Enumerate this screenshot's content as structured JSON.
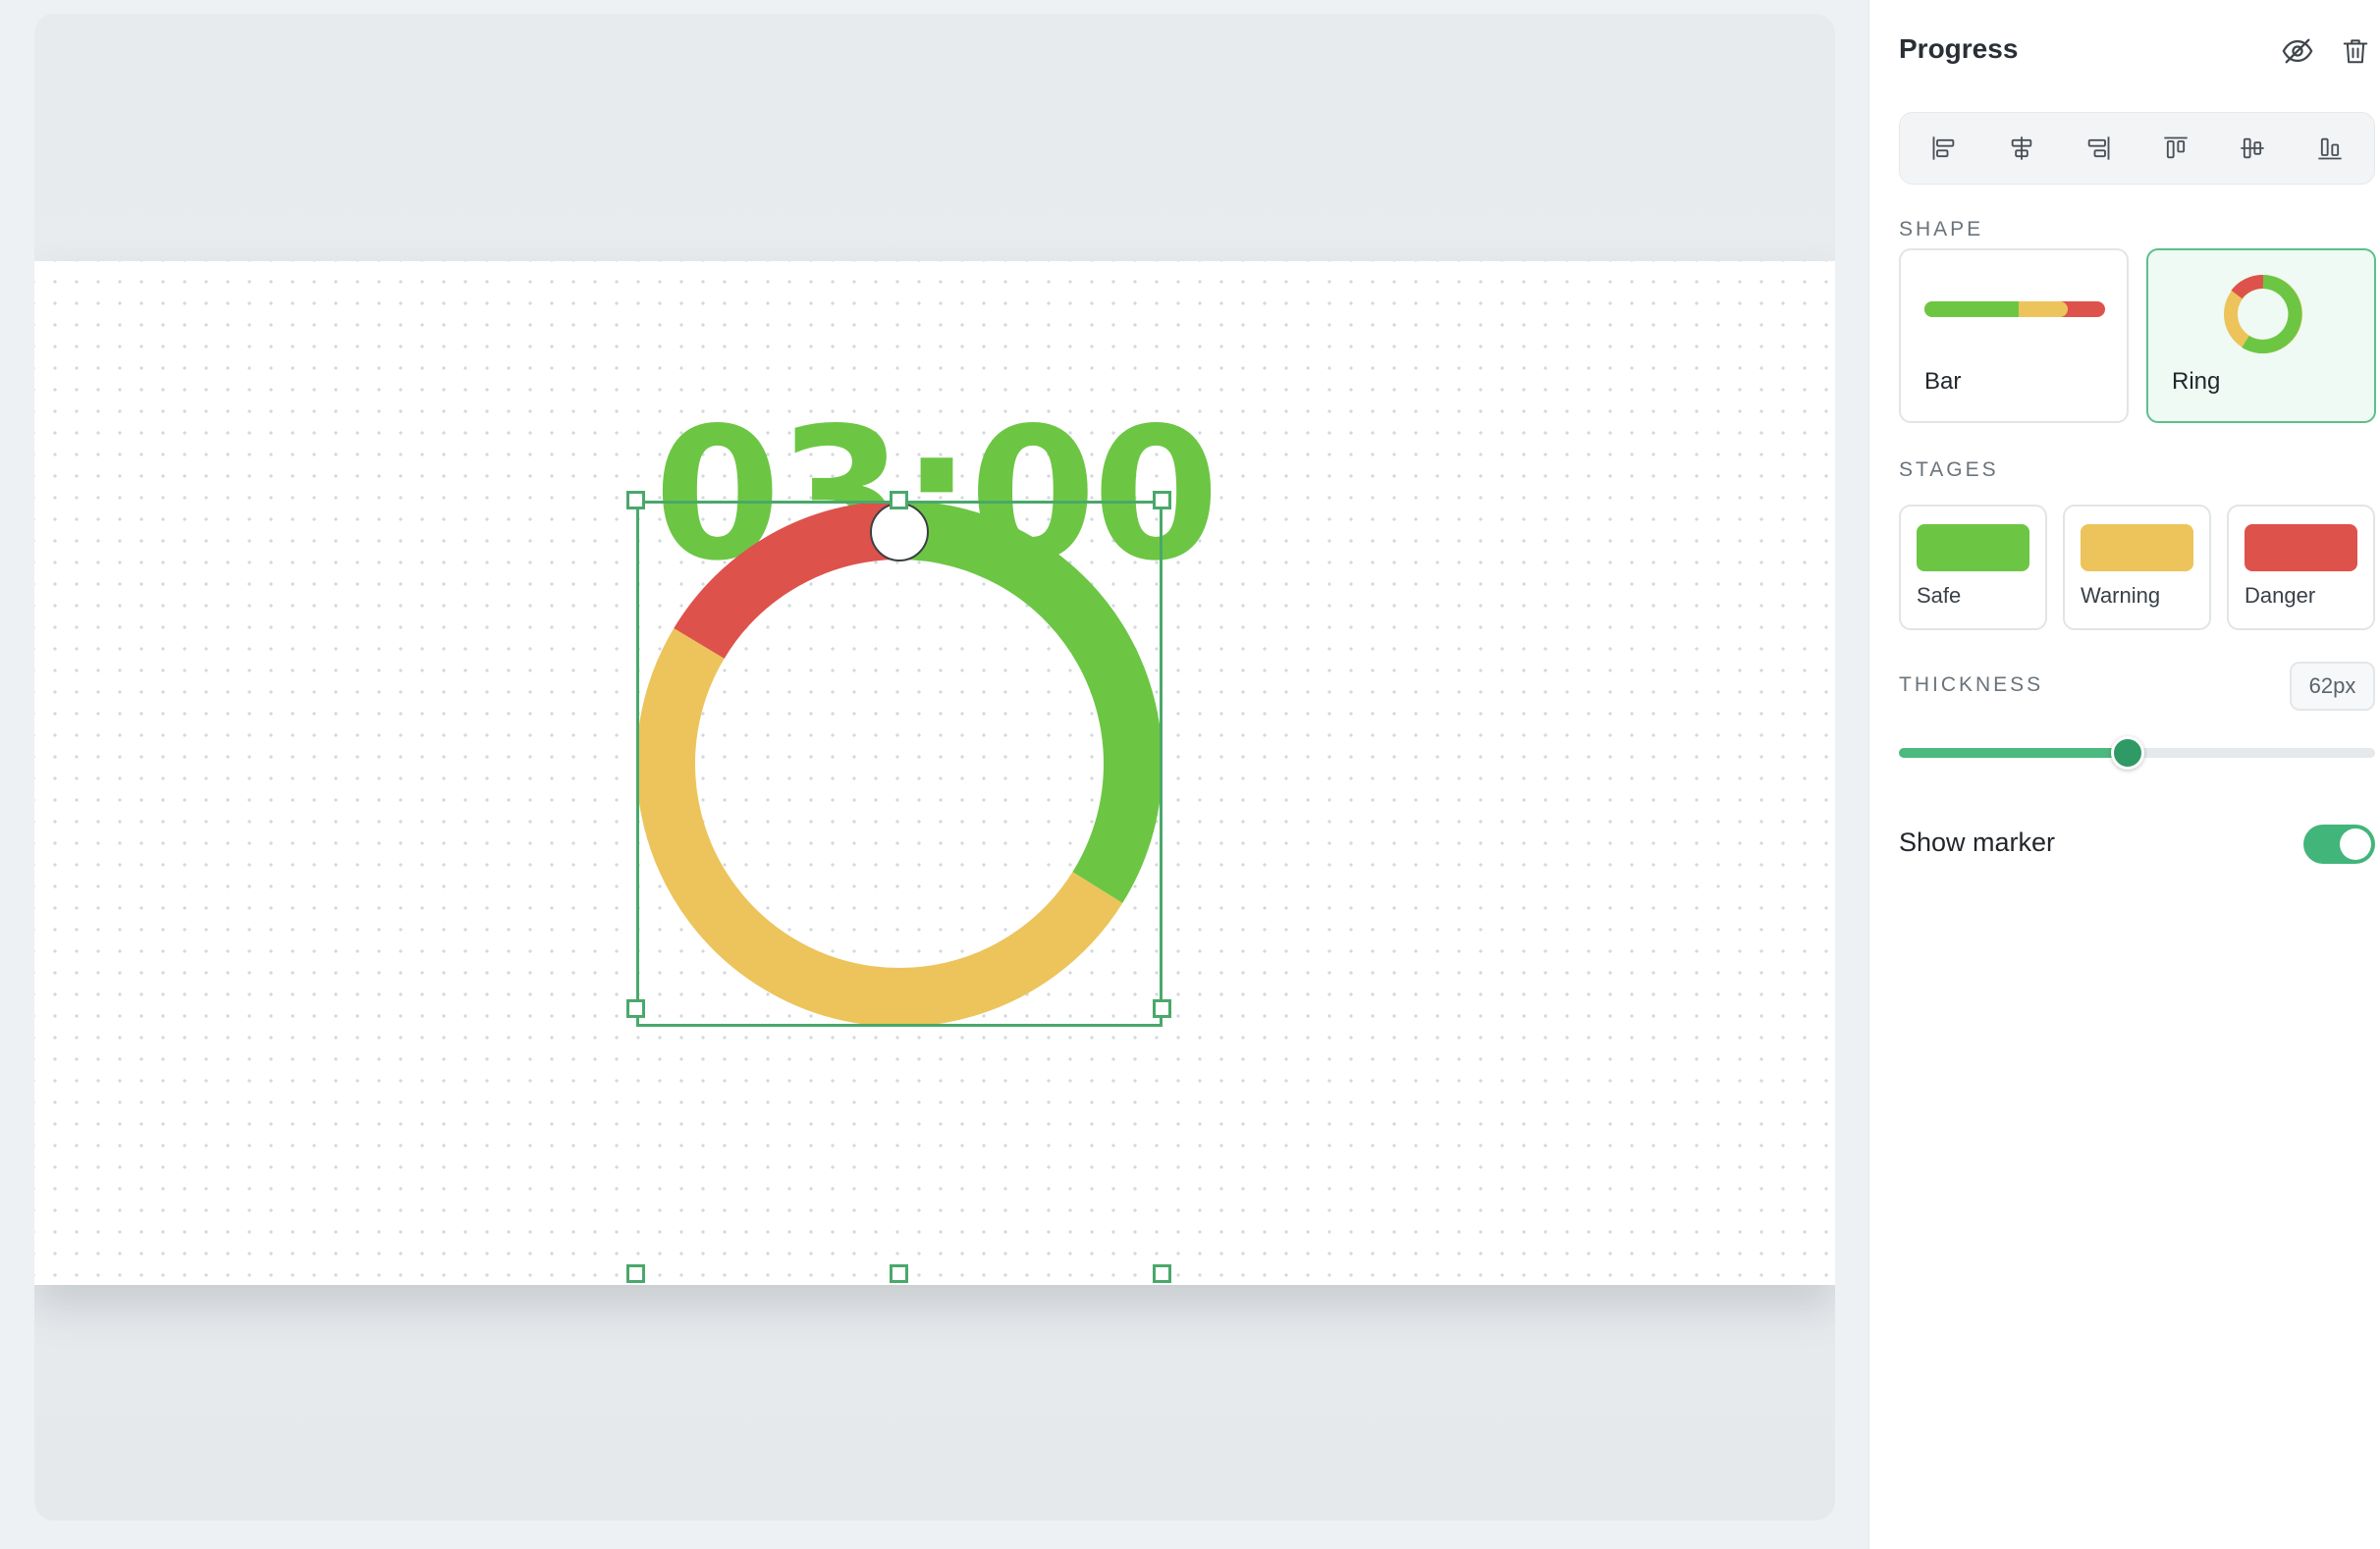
{
  "canvas": {
    "timer_text": "03:00",
    "timer_color": "#6cc644",
    "ring": {
      "thickness_px": 62,
      "show_marker": true,
      "segments": [
        {
          "stage": "Safe",
          "color": "#6cc644",
          "from_deg": 0,
          "to_deg": 122
        },
        {
          "stage": "Warning",
          "color": "#ecc45b",
          "from_deg": 122,
          "to_deg": 301
        },
        {
          "stage": "Danger",
          "color": "#de524c",
          "from_deg": 301,
          "to_deg": 360
        }
      ]
    }
  },
  "panel": {
    "title": "Progress",
    "icons": {
      "visibility": "eye-off-icon",
      "delete": "trash-icon"
    },
    "align_tools": [
      "align-left",
      "align-center-horizontal",
      "align-right",
      "align-top",
      "align-center-vertical",
      "align-bottom"
    ],
    "shape_section": {
      "label": "SHAPE",
      "options": [
        {
          "label": "Bar",
          "selected": false
        },
        {
          "label": "Ring",
          "selected": true
        }
      ]
    },
    "stages_section": {
      "label": "STAGES",
      "stages": [
        {
          "label": "Safe",
          "color": "#6cc644"
        },
        {
          "label": "Warning",
          "color": "#ecc45b"
        },
        {
          "label": "Danger",
          "color": "#de524c"
        }
      ]
    },
    "thickness_section": {
      "label": "THICKNESS",
      "value": "62px",
      "slider_fraction": 0.48
    },
    "marker": {
      "label": "Show marker",
      "enabled": true
    },
    "accent_color": "#42b57a"
  }
}
